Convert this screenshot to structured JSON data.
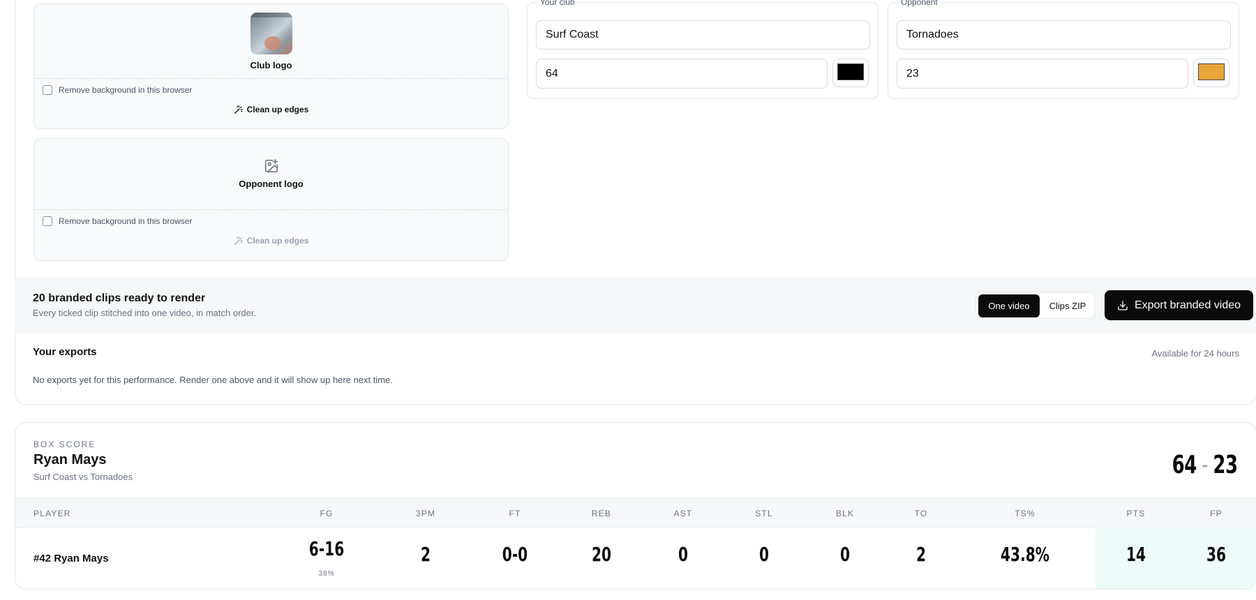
{
  "logos": {
    "club": {
      "label": "Club logo",
      "remove_bg_label": "Remove background in this browser",
      "cleanup_label": "Clean up edges"
    },
    "opponent": {
      "label": "Opponent logo",
      "remove_bg_label": "Remove background in this browser",
      "cleanup_label": "Clean up edges"
    }
  },
  "teams": {
    "club": {
      "legend": "Your club",
      "name": "Surf Coast",
      "score": "64",
      "color": "#000000"
    },
    "opponent": {
      "legend": "Opponent",
      "name": "Tornadoes",
      "score": "23",
      "color": "#E8A53A"
    }
  },
  "render": {
    "title": "20 branded clips ready to render",
    "subtitle": "Every ticked clip stitched into one video, in match order.",
    "mode_options": [
      "One video",
      "Clips ZIP"
    ],
    "selected_mode": "One video",
    "export_label": "Export branded video"
  },
  "exports": {
    "title": "Your exports",
    "availability": "Available for 24 hours",
    "empty_message": "No exports yet for this performance. Render one above and it will show up here next time."
  },
  "box_score": {
    "eyebrow": "BOX SCORE",
    "player_name": "Ryan Mays",
    "matchup": "Surf Coast vs Tornadoes",
    "score_home": "64",
    "score_separator": "-",
    "score_away": "23",
    "columns": [
      "PLAYER",
      "FG",
      "3PM",
      "FT",
      "REB",
      "AST",
      "STL",
      "BLK",
      "TO",
      "TS%",
      "PTS",
      "FP"
    ],
    "row": {
      "player": "#42 Ryan Mays",
      "fg": "6-16",
      "fg_pct": "38%",
      "three_pm": "2",
      "ft": "0-0",
      "reb": "20",
      "ast": "0",
      "stl": "0",
      "blk": "0",
      "to": "2",
      "ts_pct": "43.8%",
      "pts": "14",
      "fp": "36"
    }
  }
}
